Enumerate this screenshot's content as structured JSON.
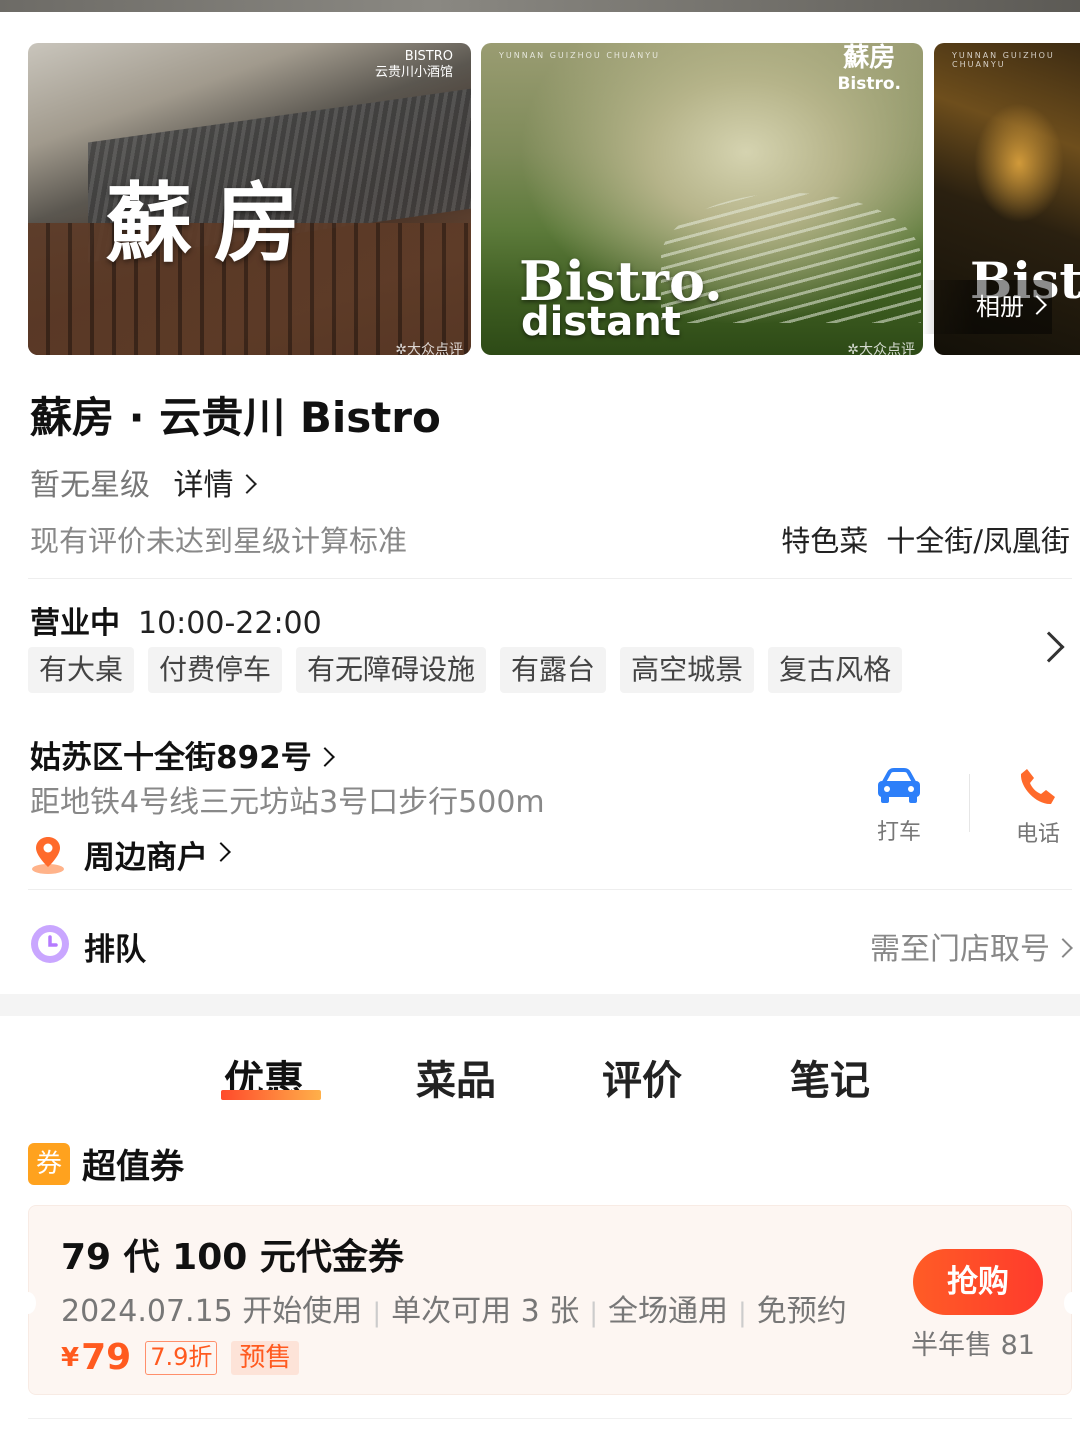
{
  "gallery": {
    "photo1": {
      "brand_en": "BISTRO",
      "brand_cn": "云贵川小酒馆",
      "big_text": "蘇房",
      "watermark": "大众点评"
    },
    "photo2": {
      "logo_cn": "蘇房",
      "logo_en": "Bistro.",
      "big_line1": "Bistro.",
      "big_line2": "distant",
      "watermark": "大众点评",
      "tiny": "YUNNAN GUIZHOU CHUANYU"
    },
    "photo3": {
      "tiny": "YUNNAN GUIZHOU CHUANYU",
      "big_text": "Bistro Tavern"
    },
    "album_label": "相册"
  },
  "shop": {
    "name": "蘇房 · 云贵川 Bistro",
    "star_level": "暂无星级",
    "detail_link": "详情",
    "rating_note": "现有评价未达到星级计算标准",
    "specialty": "特色菜",
    "district": "十全街/凤凰街"
  },
  "hours": {
    "status": "营业中",
    "time": "10:00-22:00",
    "tags": [
      "有大桌",
      "付费停车",
      "有无障碍设施",
      "有露台",
      "高空城景",
      "复古风格"
    ]
  },
  "location": {
    "address": "姑苏区十全街892号",
    "metro": "距地铁4号线三元坊站3号口步行500m",
    "nearby": "周边商户",
    "taxi_label": "打车",
    "phone_label": "电话"
  },
  "queue": {
    "label": "排队",
    "note": "需至门店取号"
  },
  "tabs": [
    "优惠",
    "菜品",
    "评价",
    "笔记"
  ],
  "deals": {
    "section_icon": "券",
    "section_title": "超值券",
    "coupon": {
      "title": "79 代 100 元代金券",
      "meta": [
        "2024.07.15 开始使用",
        "单次可用 3 张",
        "全场通用",
        "免预约"
      ],
      "currency": "¥",
      "price": "79",
      "discount": "7.9折",
      "presale": "预售",
      "buy_label": "抢购",
      "sold": "半年售 81"
    }
  },
  "colors": {
    "accent": "#ff5a1f",
    "tab_underline_start": "#ff4a2b",
    "tab_underline_end": "#ffb04a",
    "coupon_bg": "#fdf6f2",
    "taxi_blue": "#2d7ff9",
    "phone_orange": "#ff6a2b",
    "queue_purple": "#b57bff"
  }
}
